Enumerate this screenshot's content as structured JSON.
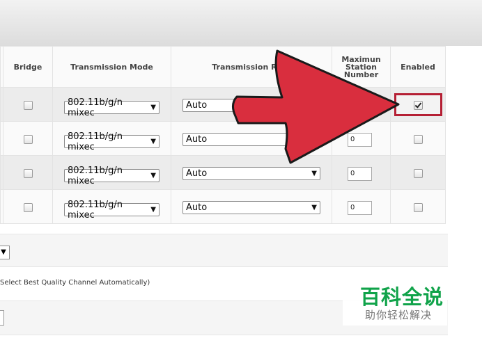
{
  "table": {
    "headers": {
      "bridge": "Bridge",
      "mode": "Transmission Mode",
      "rate": "Transmission Rate",
      "max_station": [
        "Maximun",
        "Station",
        "Number"
      ],
      "enabled": "Enabled"
    },
    "rows": [
      {
        "mode": "802.11b/g/n mixec",
        "rate": "Auto",
        "max_station": "",
        "bridge_checked": false,
        "enabled_checked": true
      },
      {
        "mode": "802.11b/g/n mixec",
        "rate": "Auto",
        "max_station": "0",
        "bridge_checked": false,
        "enabled_checked": false
      },
      {
        "mode": "802.11b/g/n mixec",
        "rate": "Auto",
        "max_station": "0",
        "bridge_checked": false,
        "enabled_checked": false
      },
      {
        "mode": "802.11b/g/n mixec",
        "rate": "Auto",
        "max_station": "0",
        "bridge_checked": false,
        "enabled_checked": false
      }
    ]
  },
  "channel_hint": "Select Best Quality Channel Automatically)",
  "overlay": {
    "arrow_color": "#d92e3e",
    "highlight_color": "#b51f34"
  },
  "watermark": {
    "title": "百科全说",
    "subtitle": "助你轻松解决",
    "color": "#10a34a"
  },
  "icons": {
    "dropdown": "▼"
  }
}
